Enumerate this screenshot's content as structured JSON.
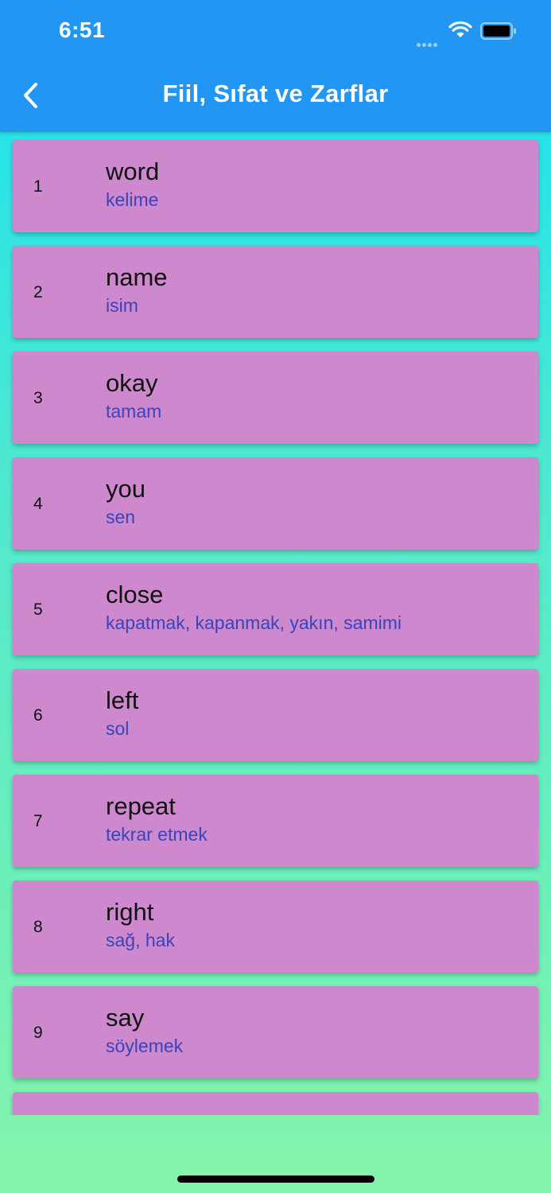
{
  "status_bar": {
    "time": "6:51"
  },
  "header": {
    "title": "Fiil, Sıfat ve Zarflar",
    "back_icon": "chevron-left-icon"
  },
  "words": [
    {
      "index": "1",
      "word": "word",
      "meaning": "kelime"
    },
    {
      "index": "2",
      "word": "name",
      "meaning": "isim"
    },
    {
      "index": "3",
      "word": "okay",
      "meaning": "tamam"
    },
    {
      "index": "4",
      "word": "you",
      "meaning": "sen"
    },
    {
      "index": "5",
      "word": "close",
      "meaning": "kapatmak, kapanmak, yakın, samimi"
    },
    {
      "index": "6",
      "word": "left",
      "meaning": "sol"
    },
    {
      "index": "7",
      "word": "repeat",
      "meaning": "tekrar etmek"
    },
    {
      "index": "8",
      "word": "right",
      "meaning": "sağ, hak"
    },
    {
      "index": "9",
      "word": "say",
      "meaning": "söylemek"
    }
  ],
  "colors": {
    "app_bar": "#2196f3",
    "card": "#cd88ce",
    "meaning_text": "#3a44b8",
    "background_top": "#17e2f2",
    "background_bottom": "#86f3ad"
  }
}
